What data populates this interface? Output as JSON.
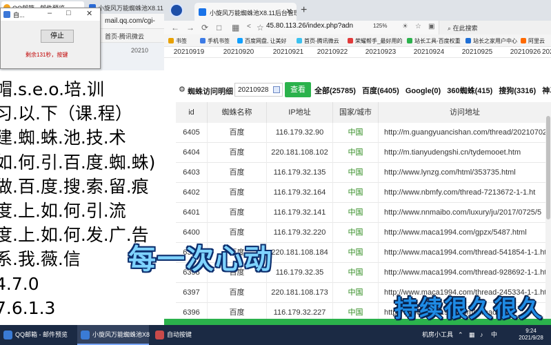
{
  "left_window": {
    "tab1": "QQ邮箱 - 邮件预览",
    "tab2": "小旋风万能蜘蛛池X8.11",
    "url": "mail.qq.com/cgi-",
    "bookmark": "首页-腾讯微云",
    "bookmark_left": "约",
    "date_fragment": "20210",
    "mini_text": "0",
    "course_lines": [
      "帽.s.e.o.培.训",
      "习.以.下（课.程）",
      "建.蜘.蛛.池.技.术",
      "如.何.引.百.度.蜘.蛛)",
      "做.百.度.搜.索.留.痕",
      "度.上.如.何.引.流",
      "度.上.如.何.发.广.告",
      "系.我.薇.信",
      "4.7.0",
      "7.6.1.3"
    ]
  },
  "popup": {
    "title": "自...",
    "stop_label": "停止",
    "status": "剩余131秒，按键"
  },
  "right_window": {
    "tab_title": "小旋风万能蜘蛛池X8.11后台管理",
    "url": "45.80.113.26/index.php?adn",
    "zoom": "125%",
    "search_label": "在此搜索",
    "bookmarks": [
      "书签",
      "手机书签",
      "百度网盘, 让美好",
      "首页-腾讯微云",
      "荣耀帮手_最好用的",
      "站长工具-百度权重",
      "站长之家用户中心",
      "阿里云"
    ],
    "dates": [
      "20210919",
      "20210920",
      "20210921",
      "20210922",
      "20210923",
      "20210924",
      "20210925",
      "20210926",
      "2021"
    ],
    "panel_title": "蜘蛛访问明细",
    "date_value": "20210928",
    "query_button": "查看",
    "filters": [
      "全部(25785)",
      "百度(6405)",
      "Google(0)",
      "360蜘蛛(415)",
      "搜狗(3316)",
      "神马"
    ],
    "columns": [
      "id",
      "蜘蛛名称",
      "IP地址",
      "国家/城市",
      "访问地址"
    ],
    "rows": [
      {
        "id": "6405",
        "name": "百度",
        "ip": "116.179.32.90",
        "country": "中国",
        "url": "http://m.guangyuancishan.com/thread/20210702"
      },
      {
        "id": "6404",
        "name": "百度",
        "ip": "220.181.108.102",
        "country": "中国",
        "url": "http://m.tianyudengshi.cn/tydemooet.htm"
      },
      {
        "id": "6403",
        "name": "百度",
        "ip": "116.179.32.135",
        "country": "中国",
        "url": "http://www.lynzg.com/html/353735.html"
      },
      {
        "id": "6402",
        "name": "百度",
        "ip": "116.179.32.164",
        "country": "中国",
        "url": "http://www.nbmfy.com/thread-7213672-1-1.ht"
      },
      {
        "id": "6401",
        "name": "百度",
        "ip": "116.179.32.141",
        "country": "中国",
        "url": "http://www.nnmaibo.com/luxury/ju/2017/0725/5"
      },
      {
        "id": "6400",
        "name": "百度",
        "ip": "116.179.32.220",
        "country": "中国",
        "url": "http://www.maca1994.com/gpzx/5487.html"
      },
      {
        "id": "6399",
        "name": "百度",
        "ip": "220.181.108.184",
        "country": "中国",
        "url": "http://www.maca1994.com/thread-541854-1-1.ht"
      },
      {
        "id": "6398",
        "name": "百度",
        "ip": "116.179.32.35",
        "country": "中国",
        "url": "http://www.maca1994.com/thread-928692-1-1.ht"
      },
      {
        "id": "6397",
        "name": "百度",
        "ip": "220.181.108.173",
        "country": "中国",
        "url": "http://www.maca1994.com/thread-245334-1-1.ht"
      },
      {
        "id": "6396",
        "name": "百度",
        "ip": "116.179.32.227",
        "country": "中国",
        "url": "http://www.maca1994.com/thread-5"
      }
    ]
  },
  "overlays": {
    "caption1": "每一次心动",
    "caption2": "持续很久很久"
  },
  "taskbar": {
    "items": [
      "QQ邮箱 - 邮件预览",
      "小旋风万能蜘蛛池X8",
      "自动按键"
    ],
    "tray_label": "机房小工具",
    "clock_time": "9:24",
    "clock_date": "2021/9/28"
  },
  "colors": {
    "accent_green": "#2bb24c",
    "country_green": "#2c8a1c",
    "status_red": "#c00000",
    "taskbar": "#1b2a44"
  }
}
